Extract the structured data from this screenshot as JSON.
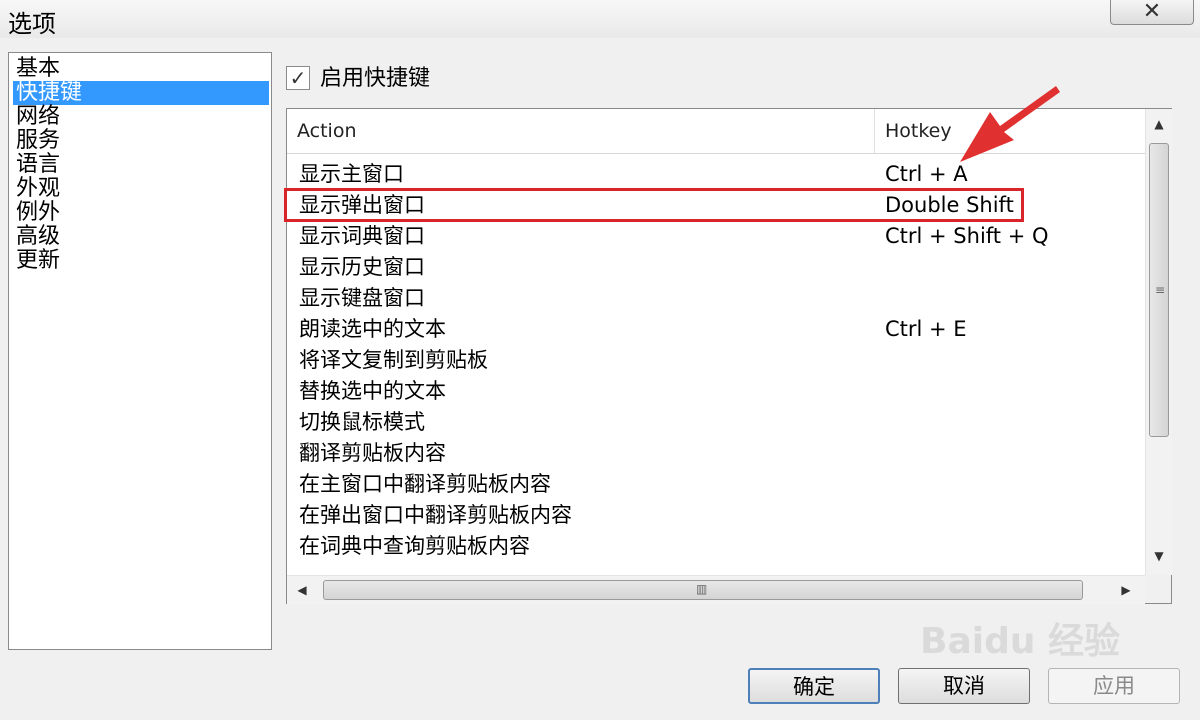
{
  "window": {
    "title": "选项",
    "close_label": "✕"
  },
  "nav": {
    "items": [
      {
        "label": "基本",
        "selected": false
      },
      {
        "label": "快捷键",
        "selected": true
      },
      {
        "label": "网络",
        "selected": false
      },
      {
        "label": "服务",
        "selected": false
      },
      {
        "label": "语言",
        "selected": false
      },
      {
        "label": "外观",
        "selected": false
      },
      {
        "label": "例外",
        "selected": false
      },
      {
        "label": "高级",
        "selected": false
      },
      {
        "label": "更新",
        "selected": false
      }
    ]
  },
  "hotkeys": {
    "enable_label": "启用快捷键",
    "enabled": true,
    "check_mark": "✓",
    "columns": {
      "action": "Action",
      "hotkey": "Hotkey"
    },
    "rows": [
      {
        "action": "显示主窗口",
        "hotkey": "Ctrl + A"
      },
      {
        "action": "显示弹出窗口",
        "hotkey": "Double Shift"
      },
      {
        "action": "显示词典窗口",
        "hotkey": "Ctrl + Shift + Q"
      },
      {
        "action": "显示历史窗口",
        "hotkey": ""
      },
      {
        "action": "显示键盘窗口",
        "hotkey": ""
      },
      {
        "action": "朗读选中的文本",
        "hotkey": "Ctrl + E"
      },
      {
        "action": "将译文复制到剪贴板",
        "hotkey": ""
      },
      {
        "action": "替换选中的文本",
        "hotkey": ""
      },
      {
        "action": "切换鼠标模式",
        "hotkey": ""
      },
      {
        "action": "翻译剪贴板内容",
        "hotkey": ""
      },
      {
        "action": "在主窗口中翻译剪贴板内容",
        "hotkey": ""
      },
      {
        "action": "在弹出窗口中翻译剪贴板内容",
        "hotkey": ""
      },
      {
        "action": "在词典中查询剪贴板内容",
        "hotkey": ""
      }
    ]
  },
  "buttons": {
    "ok": "确定",
    "cancel": "取消",
    "apply": "应用"
  },
  "watermark": "Baidu 经验",
  "colors": {
    "selection": "#3399ff",
    "highlight": "#d9252a"
  }
}
